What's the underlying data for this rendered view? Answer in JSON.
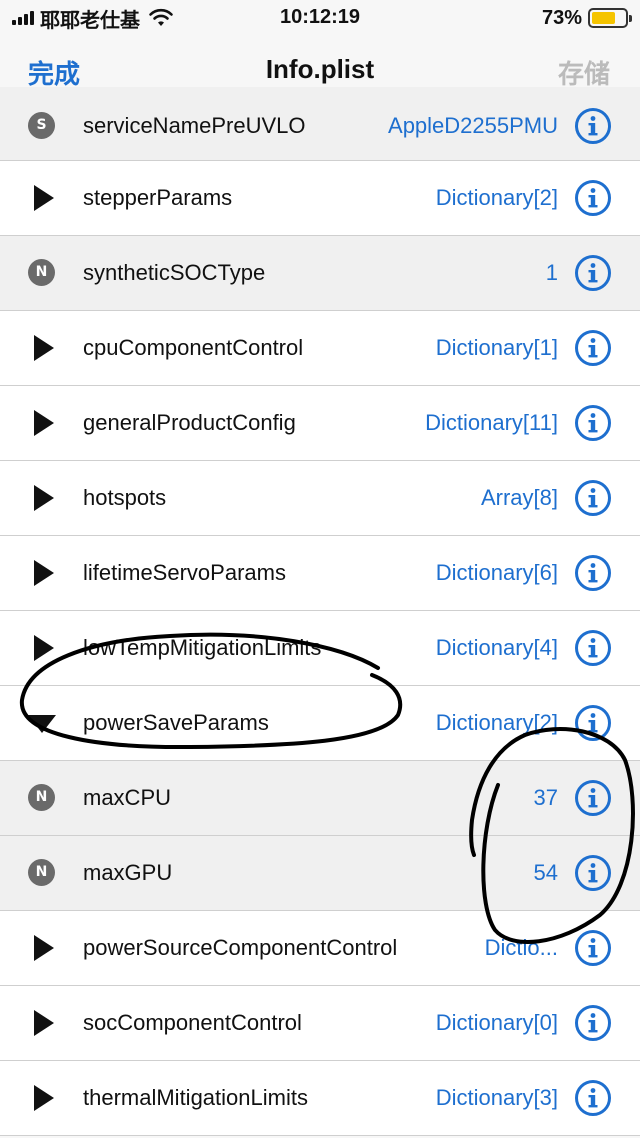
{
  "status_bar": {
    "carrier": "耶耶老仕基",
    "time": "10:12:19",
    "battery_percent": "73%",
    "battery_level": 0.73
  },
  "nav": {
    "left_label": "完成",
    "title": "Info.plist",
    "right_label": "存储"
  },
  "rows": [
    {
      "kind": "string",
      "badge": "S",
      "key": "serviceNamePreUVLO",
      "value": "AppleD2255PMU",
      "shade": "grey"
    },
    {
      "kind": "collapsed",
      "key": "stepperParams",
      "value": "Dictionary[2]",
      "shade": "white"
    },
    {
      "kind": "number",
      "badge": "N",
      "key": "syntheticSOCType",
      "value": "1",
      "shade": "grey"
    },
    {
      "kind": "collapsed",
      "key": "cpuComponentControl",
      "value": "Dictionary[1]",
      "shade": "white"
    },
    {
      "kind": "collapsed",
      "key": "generalProductConfig",
      "value": "Dictionary[11]",
      "shade": "white"
    },
    {
      "kind": "collapsed",
      "key": "hotspots",
      "value": "Array[8]",
      "shade": "white"
    },
    {
      "kind": "collapsed",
      "key": "lifetimeServoParams",
      "value": "Dictionary[6]",
      "shade": "white"
    },
    {
      "kind": "collapsed",
      "key": "lowTempMitigationLimits",
      "value": "Dictionary[4]",
      "shade": "white"
    },
    {
      "kind": "expanded",
      "key": "powerSaveParams",
      "value": "Dictionary[2]",
      "shade": "white"
    },
    {
      "kind": "number",
      "badge": "N",
      "key": "maxCPU",
      "value": "37",
      "shade": "grey"
    },
    {
      "kind": "number",
      "badge": "N",
      "key": "maxGPU",
      "value": "54",
      "shade": "grey"
    },
    {
      "kind": "collapsed",
      "key": "powerSourceComponentControl",
      "value": "Dictio...",
      "shade": "white"
    },
    {
      "kind": "collapsed",
      "key": "socComponentControl",
      "value": "Dictionary[0]",
      "shade": "white"
    },
    {
      "kind": "collapsed",
      "key": "thermalMitigationLimits",
      "value": "Dictionary[3]",
      "shade": "white"
    }
  ],
  "colors": {
    "accent": "#1e6fcf",
    "disabled": "#bbbbbb",
    "battery": "#f5c400",
    "badge": "#6a6a6a"
  },
  "icons": {
    "info": "info-circle-icon",
    "disclosure_collapsed": "triangle-right-icon",
    "disclosure_expanded": "triangle-down-icon"
  }
}
